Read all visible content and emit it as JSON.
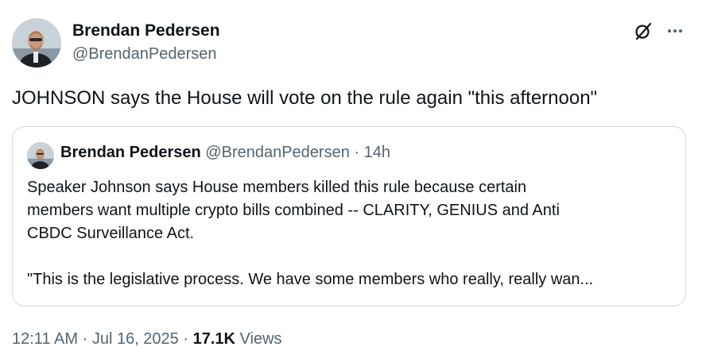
{
  "tweet": {
    "author_name": "Brendan Pedersen",
    "author_handle": "@BrendanPedersen",
    "text": "JOHNSON says the House will vote on the rule again \"this afternoon\"",
    "time": "12:11 AM",
    "date": "Jul 16, 2025",
    "separator": "·",
    "views_count": "17.1K",
    "views_label": "Views"
  },
  "icons": {
    "top_right": [
      "grok-icon",
      "more-options-icon"
    ],
    "avatar": "profile-photo"
  },
  "quote": {
    "author_name": "Brendan Pedersen",
    "author_handle": "@BrendanPedersen",
    "separator": "·",
    "age": "14h",
    "lines": [
      "Speaker Johnson says House members  killed this rule because certain",
      "members want multiple crypto bills combined -- CLARITY, GENIUS and Anti",
      "CBDC Surveillance Act."
    ],
    "quote_line": "\"This is the legislative process. We have some members who really, really wan..."
  },
  "colors": {
    "text_primary": "#0f1419",
    "text_secondary": "#536471",
    "border": "#cfd9de",
    "background": "#ffffff"
  }
}
